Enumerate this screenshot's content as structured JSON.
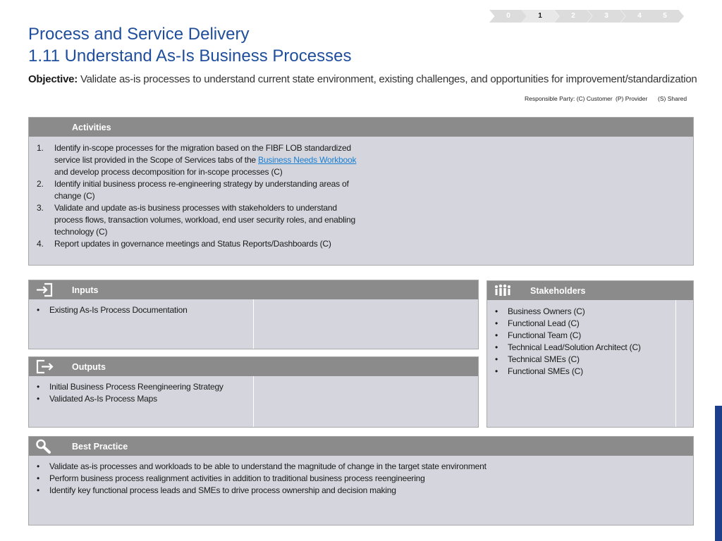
{
  "phases": [
    {
      "label": "0",
      "active": false
    },
    {
      "label": "1",
      "active": true
    },
    {
      "label": "2",
      "active": false
    },
    {
      "label": "3",
      "active": false
    },
    {
      "label": "4",
      "active": false
    },
    {
      "label": "5",
      "active": false
    }
  ],
  "title_line1": "Process and Service Delivery",
  "title_line2": "1.11 Understand As-Is Business Processes",
  "objective": {
    "label": "Objective:",
    "text": " Validate as-is processes to understand current state environment, existing challenges, and opportunities for improvement/standardization"
  },
  "responsible": {
    "label": "Responsible Party: (C) Customer",
    "provider": "(P) Provider",
    "shared": "(S) Shared"
  },
  "activities": {
    "header": "Activities",
    "items": [
      {
        "num": "1.",
        "text_before": "Identify in-scope processes for the migration based on the FIBF LOB standardized service list  provided in the Scope of Services tabs of the ",
        "link": "Business Needs Workbook ",
        "text_after": "and  develop process decomposition for in-scope processes (C)"
      },
      {
        "num": "2.",
        "text": "Identify initial business process re-engineering strategy by understanding areas of change (C)"
      },
      {
        "num": "3.",
        "text": "Validate and update as-is business processes with stakeholders to understand process flows, transaction volumes, workload, end user security roles, and enabling technology (C)"
      },
      {
        "num": "4.",
        "text": "Report updates in governance meetings and Status Reports/Dashboards (C)"
      }
    ]
  },
  "inputs": {
    "header": "Inputs",
    "icon": "sign-in-icon",
    "items": [
      "Existing As-Is Process Documentation"
    ]
  },
  "outputs": {
    "header": "Outputs",
    "icon": "sign-out-icon",
    "items": [
      "Initial Business Process Reengineering Strategy",
      "Validated As-Is Process Maps"
    ]
  },
  "stakeholders": {
    "header": "Stakeholders",
    "icon": "people-group-icon",
    "items": [
      "Business Owners (C)",
      "Functional Lead (C)",
      "Functional Team (C)",
      "Technical Lead/Solution Architect (C)",
      "Technical SMEs (C)",
      "Functional SMEs (C)"
    ]
  },
  "best_practice": {
    "header": "Best Practice",
    "icon": "magnifier-icon",
    "items": [
      "Validate as-is processes and workloads to be able to understand the magnitude of change in the target state environment",
      "Perform business process realignment activities in addition to traditional business process reengineering",
      "Identify key functional process leads and SMEs to drive process ownership and decision making"
    ]
  },
  "bullet": "•",
  "colors": {
    "title": "#1f4e9c",
    "header_bar": "#8b8b8b",
    "box_body": "#d4d5dd",
    "link": "#1a7fd1",
    "accent": "#1c3f8c"
  }
}
